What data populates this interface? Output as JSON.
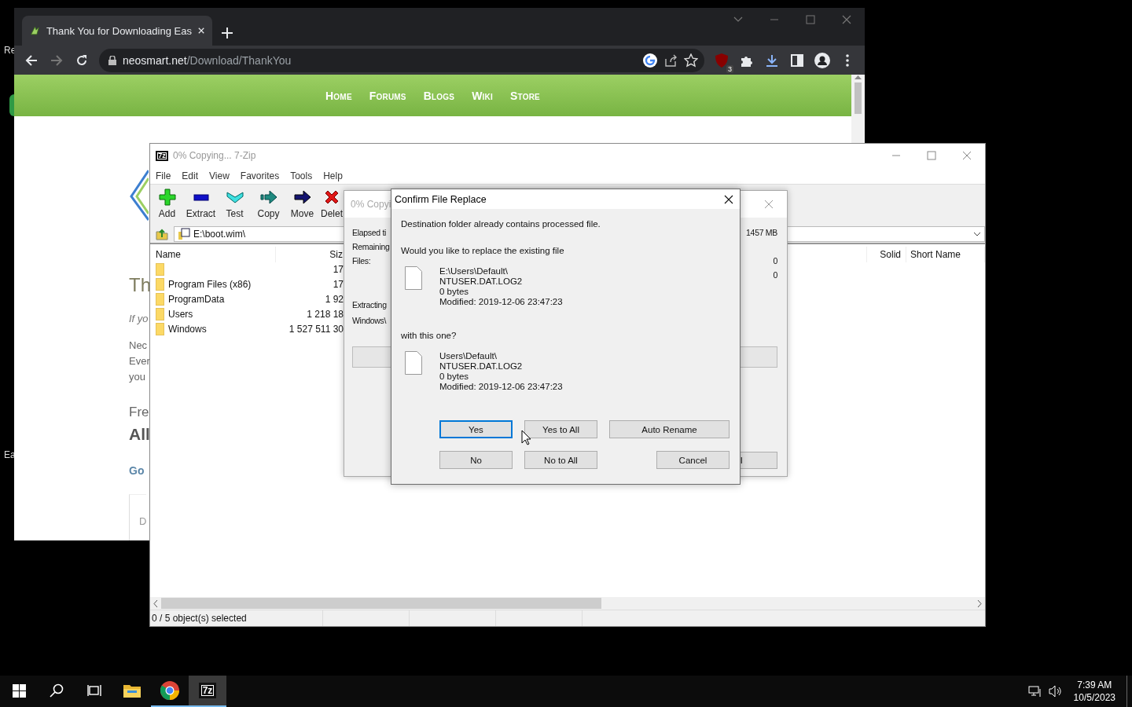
{
  "desktop": {
    "icon_labels": [
      "Re",
      "Ea"
    ]
  },
  "browser": {
    "tabs": [
      {
        "title": "Thank You for Downloading Eas",
        "selected": true
      }
    ],
    "address": {
      "host": "neosmart.net",
      "path": "/Download/ThankYou"
    },
    "extension_badge": "3",
    "site_nav": [
      "Home",
      "Forums",
      "Blogs",
      "Wiki",
      "Store"
    ],
    "page_fragments": [
      {
        "kind": "heading",
        "text": "Th"
      },
      {
        "kind": "italic",
        "text": "If yo"
      },
      {
        "kind": "text",
        "text": "Nec"
      },
      {
        "kind": "text",
        "text": "Ever"
      },
      {
        "kind": "text",
        "text": "you"
      },
      {
        "kind": "subheading",
        "text": "Fre"
      },
      {
        "kind": "bold",
        "text": "All"
      },
      {
        "kind": "link",
        "text": "Go"
      },
      {
        "kind": "card",
        "text": "D"
      }
    ]
  },
  "archive_window": {
    "icon_text": "7z",
    "title": "0% Copying... 7-Zip",
    "menu": [
      "File",
      "Edit",
      "View",
      "Favorites",
      "Tools",
      "Help"
    ],
    "toolbar": [
      {
        "kind": "add",
        "label": "Add"
      },
      {
        "kind": "extract",
        "label": "Extract"
      },
      {
        "kind": "test",
        "label": "Test"
      },
      {
        "kind": "copy",
        "label": "Copy"
      },
      {
        "kind": "move",
        "label": "Move"
      },
      {
        "kind": "delete",
        "label": "Delet"
      }
    ],
    "path": "E:\\boot.wim\\",
    "columns": {
      "name": "Name",
      "size": "Siz",
      "solid": "Solid",
      "short_name": "Short Name"
    },
    "rows": [
      {
        "size": "17"
      },
      {
        "name": "Program Files (x86)",
        "size": "17"
      },
      {
        "name": "ProgramData",
        "size": "1 92"
      },
      {
        "name": "Users",
        "size": "1 218 18"
      },
      {
        "name": "Windows",
        "size": "1 527 511 30"
      }
    ],
    "status_bar": "0 / 5 object(s) selected"
  },
  "progress_dialog": {
    "title": "0% Copyi",
    "rows": [
      {
        "label": "Elapsed ti",
        "value": "1457 MB"
      },
      {
        "label": "Remaining"
      },
      {
        "label": "Files:",
        "value": "0"
      },
      {
        "value": "0"
      }
    ],
    "action": "Extracting",
    "current_file": "Windows\\",
    "level": 0,
    "button": "l"
  },
  "confirm_dialog": {
    "title": "Confirm File Replace",
    "message": "Destination folder already contains processed file.",
    "question": "Would you like to replace the existing file",
    "existing_file": [
      "E:\\Users\\Default\\",
      "NTUSER.DAT.LOG2",
      "0 bytes",
      "Modified: 2019-12-06 23:47:23"
    ],
    "with_label": "with this one?",
    "new_file": [
      "Users\\Default\\",
      "NTUSER.DAT.LOG2",
      "0 bytes",
      "Modified: 2019-12-06 23:47:23"
    ],
    "buttons": [
      {
        "label": "Yes",
        "focused": true
      },
      {
        "label": "Yes to All",
        "focused": false
      },
      {
        "label": "Auto Rename",
        "focused": false
      },
      {
        "label": "No",
        "focused": false
      },
      {
        "label": "No to All",
        "focused": false
      },
      {
        "label": "Cancel",
        "focused": false
      }
    ]
  },
  "taskbar": {
    "apps": [
      {
        "kind": "start"
      },
      {
        "kind": "search"
      },
      {
        "kind": "task_view"
      },
      {
        "kind": "explorer",
        "running": false,
        "selected": false
      },
      {
        "kind": "chrome",
        "running": true,
        "selected": false
      },
      {
        "kind": "archiver",
        "icon_text": "7z",
        "running": true,
        "selected": true
      }
    ],
    "time": "7:39 AM",
    "date": "10/5/2023"
  }
}
